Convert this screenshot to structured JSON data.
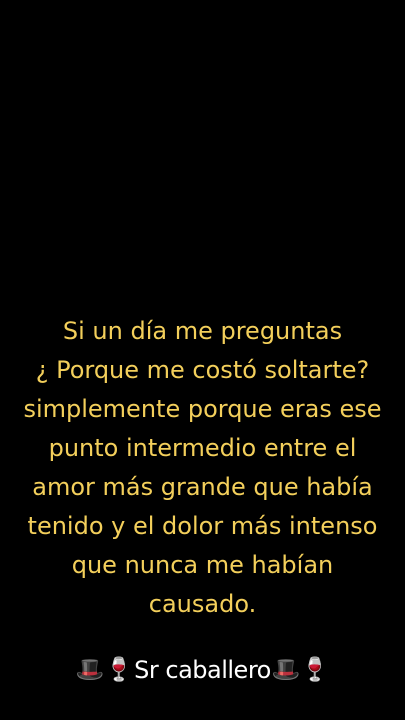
{
  "quote": {
    "lines": [
      "Si un día me preguntas",
      "¿ Porque me costó soltarte?",
      "simplemente porque eras ese",
      "punto intermedio entre el",
      "amor más grande que había",
      "tenido y el dolor más intenso",
      "que nunca me habían",
      "causado."
    ],
    "color": "#f3cf5b"
  },
  "signature": {
    "prefix_emoji": [
      "🎩",
      "🍷"
    ],
    "name": "Sr caballero",
    "suffix_emoji": [
      "🎩",
      "🍷"
    ]
  },
  "background_color": "#000000"
}
